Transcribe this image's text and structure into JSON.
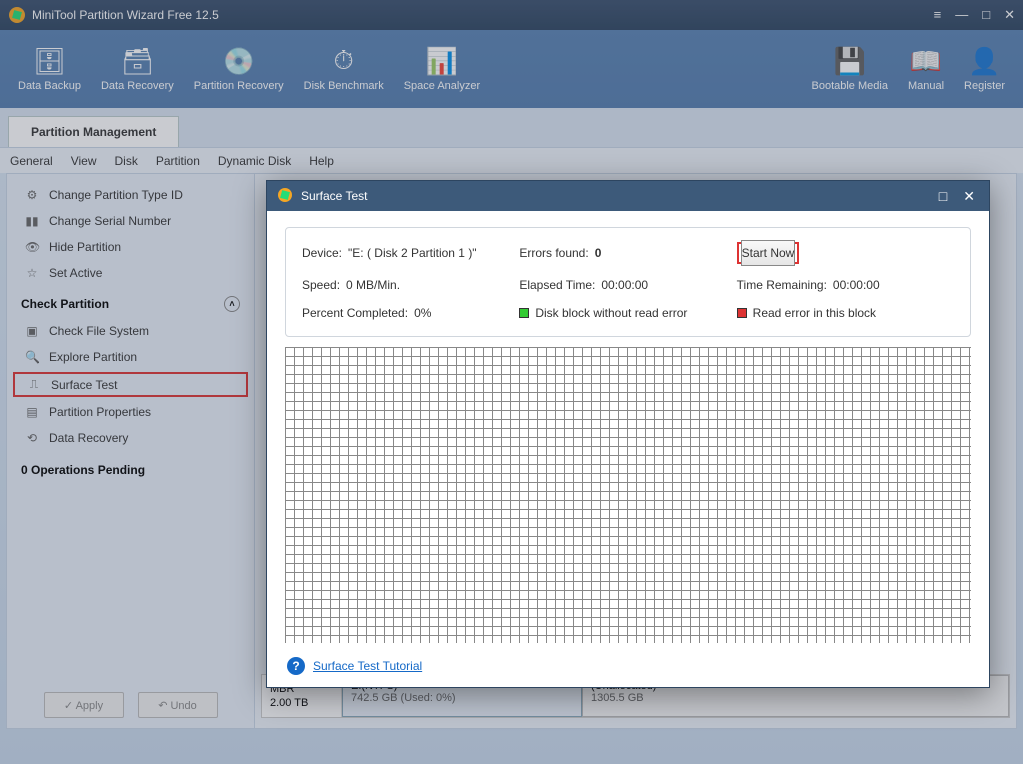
{
  "app": {
    "title": "MiniTool Partition Wizard Free 12.5"
  },
  "toolbar": {
    "items": [
      {
        "label": "Data Backup"
      },
      {
        "label": "Data Recovery"
      },
      {
        "label": "Partition Recovery"
      },
      {
        "label": "Disk Benchmark"
      },
      {
        "label": "Space Analyzer"
      }
    ],
    "right": [
      {
        "label": "Bootable Media"
      },
      {
        "label": "Manual"
      },
      {
        "label": "Register"
      }
    ]
  },
  "tab": {
    "label": "Partition Management"
  },
  "menu": [
    "General",
    "View",
    "Disk",
    "Partition",
    "Dynamic Disk",
    "Help"
  ],
  "sidebar": {
    "items1": [
      {
        "label": "Change Partition Type ID"
      },
      {
        "label": "Change Serial Number"
      },
      {
        "label": "Hide Partition"
      },
      {
        "label": "Set Active"
      }
    ],
    "section": "Check Partition",
    "items2": [
      {
        "label": "Check File System"
      },
      {
        "label": "Explore Partition"
      },
      {
        "label": "Surface Test",
        "highlight": true
      },
      {
        "label": "Partition Properties"
      },
      {
        "label": "Data Recovery"
      }
    ],
    "ops": "0 Operations Pending",
    "apply": "✓  Apply",
    "undo": "↶   Undo"
  },
  "disk": {
    "mbr": "MBR",
    "size": "2.00 TB",
    "p1_name": "E:(NTFS)",
    "p1_sub": "742.5 GB (Used: 0%)",
    "p2_name": "(Unallocated)",
    "p2_sub": "1305.5 GB"
  },
  "modal": {
    "title": "Surface Test",
    "device_lbl": "Device:",
    "device_val": "\"E: ( Disk 2 Partition 1 )\"",
    "errors_lbl": "Errors found:",
    "errors_val": "0",
    "start": "Start Now",
    "speed_lbl": "Speed:",
    "speed_val": "0 MB/Min.",
    "elapsed_lbl": "Elapsed Time:",
    "elapsed_val": "00:00:00",
    "remain_lbl": "Time Remaining:",
    "remain_val": "00:00:00",
    "percent_lbl": "Percent Completed:",
    "percent_val": "0%",
    "legend_ok": "Disk block without read error",
    "legend_err": "Read error in this block",
    "tutorial": "Surface Test Tutorial"
  }
}
